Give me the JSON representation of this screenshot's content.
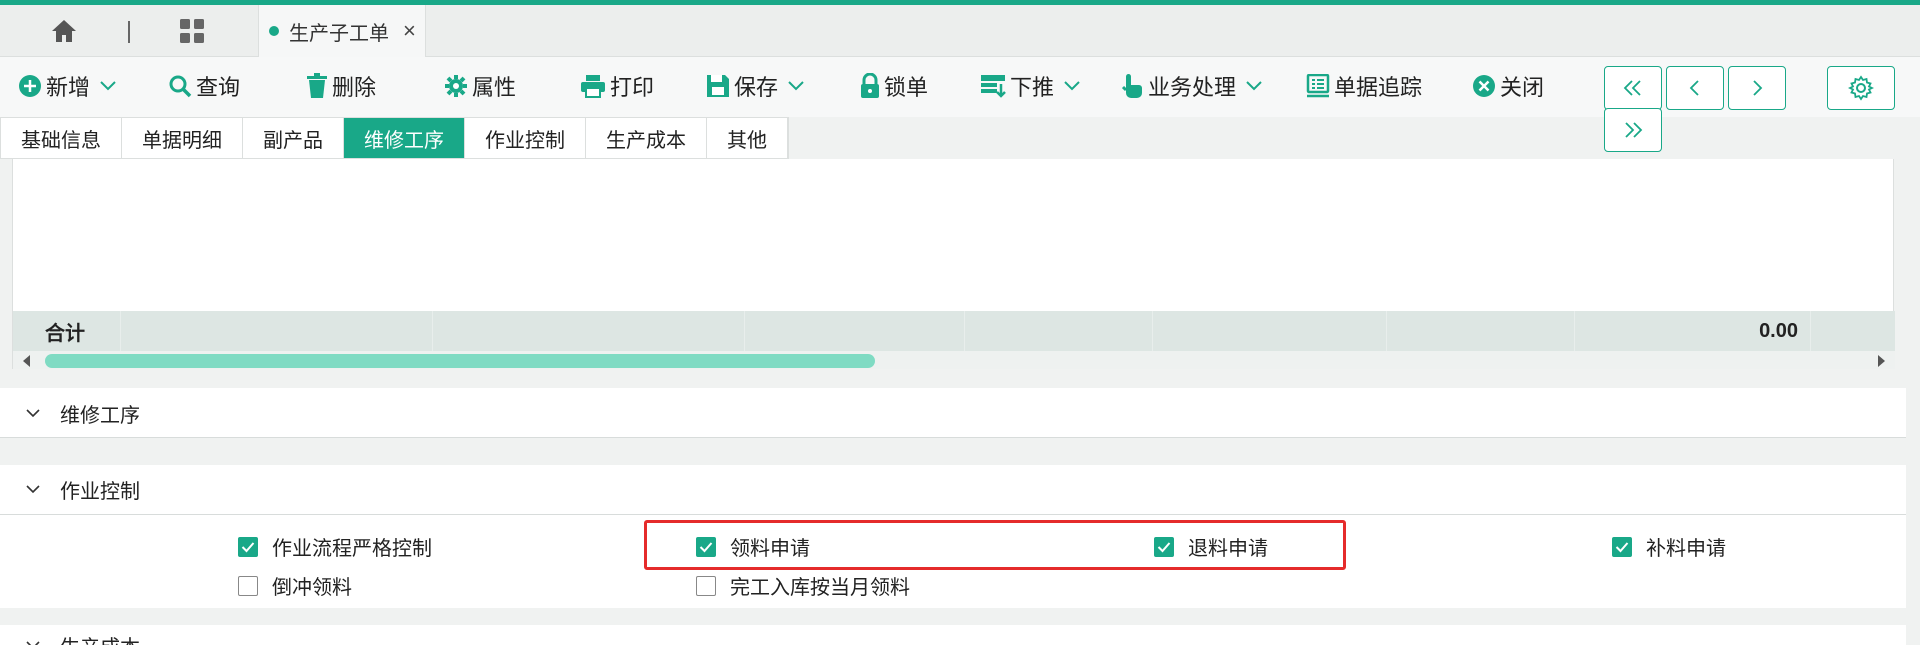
{
  "tabstrip": {
    "doc_tab_label": "生产子工单",
    "close_glyph": "×"
  },
  "toolbar": {
    "buttons": [
      {
        "label": "新增",
        "icon": "plus-circle-icon",
        "has_caret": true
      },
      {
        "label": "查询",
        "icon": "search-icon",
        "has_caret": false
      },
      {
        "label": "删除",
        "icon": "trash-icon",
        "has_caret": false
      },
      {
        "label": "属性",
        "icon": "gear-icon",
        "has_caret": false
      },
      {
        "label": "打印",
        "icon": "printer-icon",
        "has_caret": false
      },
      {
        "label": "保存",
        "icon": "save-icon",
        "has_caret": true
      },
      {
        "label": "锁单",
        "icon": "lock-icon",
        "has_caret": false
      },
      {
        "label": "下推",
        "icon": "push-down-icon",
        "has_caret": true
      },
      {
        "label": "业务处理",
        "icon": "hand-pointer-icon",
        "has_caret": true
      },
      {
        "label": "单据追踪",
        "icon": "tracking-icon",
        "has_caret": false
      },
      {
        "label": "关闭",
        "icon": "close-circle-icon",
        "has_caret": false
      }
    ]
  },
  "section_tabs": [
    {
      "label": "基础信息",
      "active": false
    },
    {
      "label": "单据明细",
      "active": false
    },
    {
      "label": "副产品",
      "active": false
    },
    {
      "label": "维修工序",
      "active": true
    },
    {
      "label": "作业控制",
      "active": false
    },
    {
      "label": "生产成本",
      "active": false
    },
    {
      "label": "其他",
      "active": false
    }
  ],
  "grid": {
    "sum_label": "合计",
    "sum_value": "0.00"
  },
  "panels": {
    "repair": {
      "title": "维修工序"
    },
    "control": {
      "title": "作业控制",
      "checkboxes": [
        {
          "label": "作业流程严格控制",
          "checked": true
        },
        {
          "label": "领料申请",
          "checked": true
        },
        {
          "label": "退料申请",
          "checked": true
        },
        {
          "label": "补料申请",
          "checked": true
        },
        {
          "label": "倒冲领料",
          "checked": false
        },
        {
          "label": "完工入库按当月领料",
          "checked": false
        }
      ]
    },
    "cost": {
      "title": "生产成本"
    }
  },
  "colors": {
    "accent": "#19a888",
    "highlight": "#e52b2b"
  }
}
